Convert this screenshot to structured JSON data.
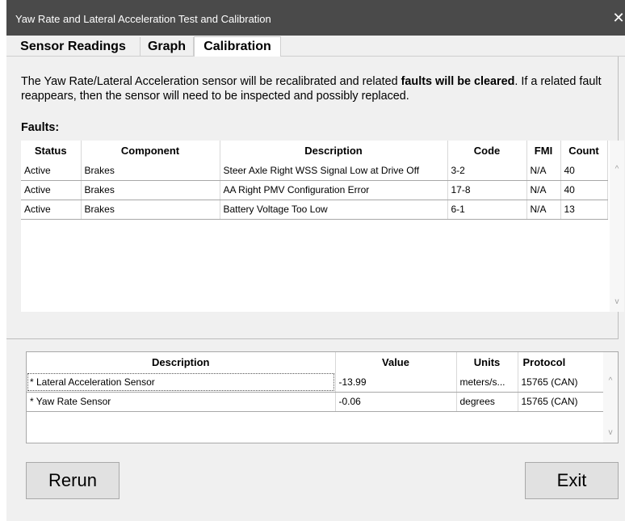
{
  "window": {
    "title": "Yaw Rate and Lateral Acceleration Test and Calibration",
    "close_glyph": "✕"
  },
  "tabs": [
    {
      "label": "Sensor Readings"
    },
    {
      "label": "Graph"
    },
    {
      "label": "Calibration"
    }
  ],
  "intro": {
    "part1": "The Yaw Rate/Lateral Acceleration sensor will be recalibrated and related ",
    "bold": "faults will be cleared",
    "part2": ". If a related fault reappears, then the sensor will  need to be inspected and possibly replaced."
  },
  "faults": {
    "label": "Faults:",
    "columns": [
      "Status",
      "Component",
      "Description",
      "Code",
      "FMI",
      "Count"
    ],
    "rows": [
      {
        "status": "Active",
        "component": "Brakes",
        "description": "Steer Axle Right WSS Signal Low at Drive Off",
        "code": "3-2",
        "fmi": "N/A",
        "count": "40"
      },
      {
        "status": "Active",
        "component": "Brakes",
        "description": "AA Right PMV Configuration Error",
        "code": "17-8",
        "fmi": "N/A",
        "count": "40"
      },
      {
        "status": "Active",
        "component": "Brakes",
        "description": "Battery Voltage Too Low",
        "code": "6-1",
        "fmi": "N/A",
        "count": "13"
      }
    ]
  },
  "sensors": {
    "columns": [
      "Description",
      "Value",
      "Units",
      "Protocol"
    ],
    "rows": [
      {
        "description": "* Lateral Acceleration Sensor",
        "value": "-13.99",
        "units": "meters/s...",
        "protocol": "15765 (CAN)"
      },
      {
        "description": "* Yaw Rate Sensor",
        "value": "-0.06",
        "units": "degrees",
        "protocol": "15765 (CAN)"
      }
    ]
  },
  "buttons": {
    "rerun": "Rerun",
    "exit": "Exit"
  },
  "scroll_glyphs": {
    "up": "^",
    "down": "v"
  }
}
